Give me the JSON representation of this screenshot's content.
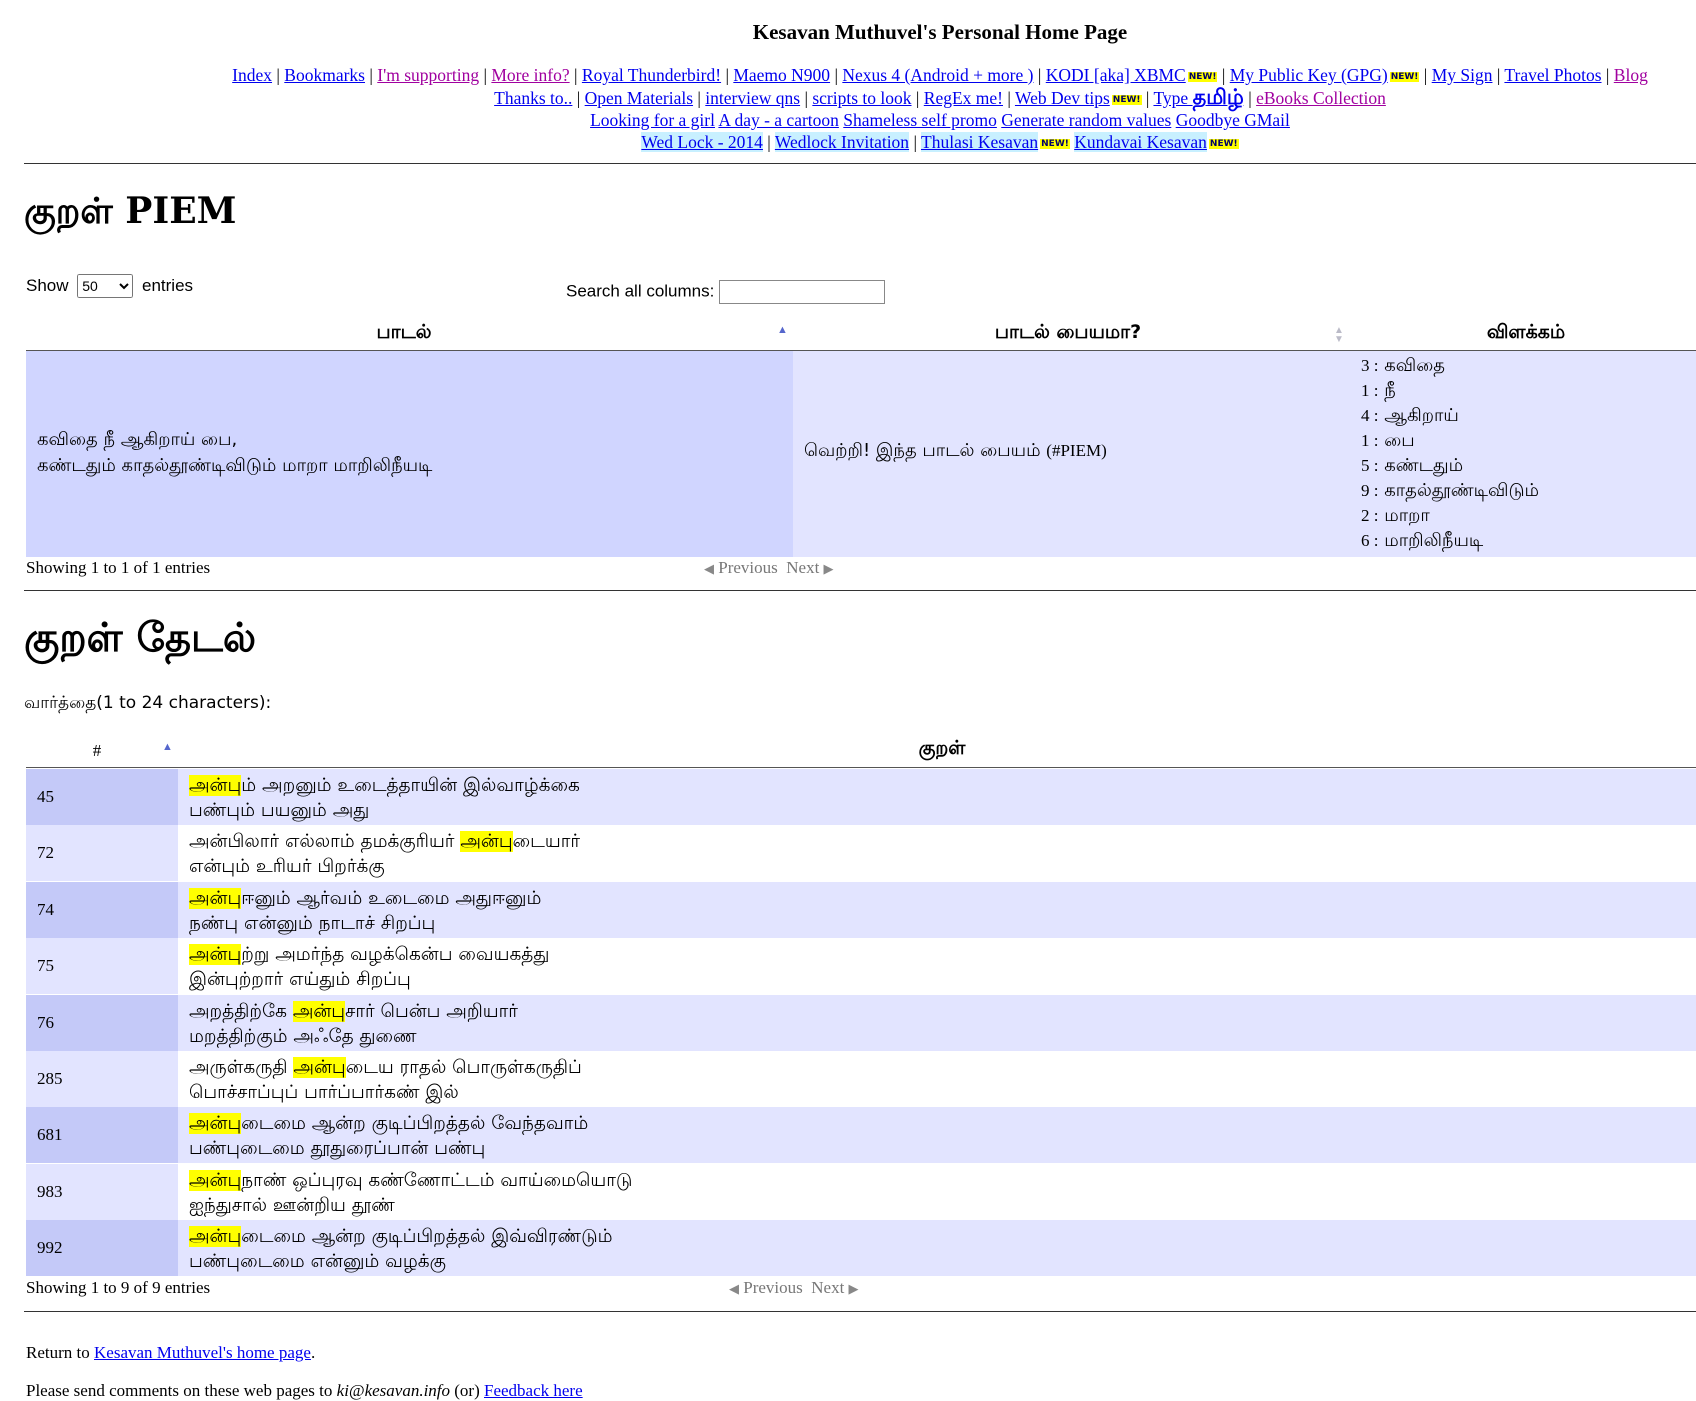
{
  "header": {
    "title": "Kesavan Muthuvel's Personal Home Page"
  },
  "nav": {
    "row1": [
      "Index",
      "Bookmarks",
      "I'm supporting",
      "More info?",
      "Royal Thunderbird!",
      "Maemo N900",
      "Nexus 4 (Android + more )",
      "KODI [aka] XBMC",
      "My Public Key (GPG)",
      "My Sign",
      "Travel Photos",
      "Blog"
    ],
    "row2": [
      "Thanks to..",
      "Open Materials",
      "interview qns",
      "scripts to look",
      "RegEx me!",
      "Web Dev tips",
      "Type ",
      "தமிழ்",
      "eBooks Collection"
    ],
    "row3": [
      "Looking for a girl",
      "A day - a cartoon",
      "Shameless self promo",
      "Generate random values",
      "Goodbye GMail"
    ],
    "row4": [
      "Wed Lock - 2014",
      "Wedlock Invitation",
      "Thulasi Kesavan",
      "Kundavai Kesavan"
    ],
    "new_badge": "NEW!",
    "separator": "|"
  },
  "piem": {
    "heading": "குறள் PIEM",
    "show_label": "Show",
    "show_value": "50",
    "entries_label": "entries",
    "search_label": "Search all columns:",
    "columns": [
      "பாடல்",
      "பாடல் பையமா?",
      "விளக்கம்"
    ],
    "row": {
      "verse_line1": "கவிதை நீ ஆகிறாய் பை,",
      "verse_line2": "கண்டதும் காதல்தூண்டிவிடும் மாறா மாறிலிநீயடி",
      "result": "வெற்றி! இந்த பாடல் பையம்",
      "result_tag": "(#PIEM)",
      "explain": [
        {
          "n": "3 :",
          "w": "கவிதை"
        },
        {
          "n": "1 :",
          "w": "நீ"
        },
        {
          "n": "4 :",
          "w": "ஆகிறாய்"
        },
        {
          "n": "1 :",
          "w": "பை"
        },
        {
          "n": "5 :",
          "w": "கண்டதும்"
        },
        {
          "n": "9 :",
          "w": "காதல்தூண்டிவிடும்"
        },
        {
          "n": "2 :",
          "w": "மாறா"
        },
        {
          "n": "6 :",
          "w": "மாறிலிநீயடி"
        }
      ]
    },
    "info": "Showing 1 to 1 of 1 entries",
    "prev": "Previous",
    "next": "Next"
  },
  "search": {
    "heading": "குறள் தேடல்",
    "word_label": "வார்த்தை(1 to 24 characters):",
    "col_num": "#",
    "col_kural": "குறள்",
    "highlight": "அன்பு",
    "rows": [
      {
        "num": "45",
        "before": "",
        "after": "ம் அறனும் உடைத்தாயின் இல்வாழ்க்கை",
        "line2": "பண்பும் பயனும் அது"
      },
      {
        "num": "72",
        "before": "அன்பிலார் எல்லாம் தமக்குரியர் ",
        "after": "டையார்",
        "line2": "என்பும் உரியர் பிறர்க்கு"
      },
      {
        "num": "74",
        "before": "",
        "after": "ஈனும் ஆர்வம் உடைமை அதுஈனும்",
        "line2": "நண்பு என்னும் நாடாச் சிறப்பு"
      },
      {
        "num": "75",
        "before": "",
        "after": "ற்று அமர்ந்த வழக்கென்ப வையகத்து",
        "line2": "இன்புற்றார் எய்தும் சிறப்பு"
      },
      {
        "num": "76",
        "before": "அறத்திற்கே ",
        "after": "சார் பென்ப அறியார்",
        "line2": "மறத்திற்கும் அஃதே துணை"
      },
      {
        "num": "285",
        "before": "அருள்கருதி ",
        "after": "டைய ராதல் பொருள்கருதிப்",
        "line2": "பொச்சாப்புப் பார்ப்பார்கண் இல்"
      },
      {
        "num": "681",
        "before": "",
        "after": "டைமை ஆன்ற குடிப்பிறத்தல் வேந்தவாம்",
        "line2": "பண்புடைமை தூதுரைப்பான் பண்பு"
      },
      {
        "num": "983",
        "before": "",
        "after": "நாண் ஒப்புரவு கண்ணோட்டம் வாய்மையொடு",
        "line2": "ஐந்துசால் ஊன்றிய தூண்"
      },
      {
        "num": "992",
        "before": "",
        "after": "டைமை ஆன்ற குடிப்பிறத்தல் இவ்விரண்டும்",
        "line2": "பண்புடைமை என்னும் வழக்கு"
      }
    ],
    "info": "Showing 1 to 9 of 9 entries",
    "prev": "Previous",
    "next": "Next"
  },
  "footer": {
    "return_text": "Return to ",
    "return_link": "Kesavan Muthuvel's home page",
    "return_end": ".",
    "comments_text": "Please send comments on these web pages to ",
    "email": "ki@kesavan.info",
    "or_text": " (or) ",
    "feedback_link": "Feedback here"
  },
  "colors": {
    "row_dark": "#d0d5ff",
    "row_light": "#e2e4ff",
    "sorted_dark": "#c4c9f8",
    "sorted_light": "#d3d6fa",
    "highlight": "#ffff00"
  }
}
